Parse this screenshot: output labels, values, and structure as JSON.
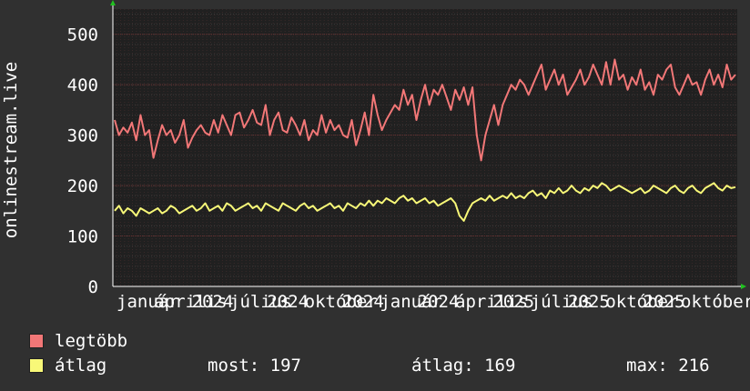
{
  "chart_data": {
    "type": "line",
    "ylabel": "onlinestream.live",
    "ylim": [
      0,
      550
    ],
    "y_ticks": [
      "0",
      "100",
      "200",
      "300",
      "400",
      "500"
    ],
    "x_tick_labels": [
      "január",
      "április",
      "2024",
      "július",
      "2024",
      "október",
      "2024",
      "január",
      "2024",
      "április",
      "2025",
      "július",
      "2025",
      "október",
      "2025",
      "október"
    ],
    "series": [
      {
        "name": "legtöbb",
        "color": "#f27777",
        "values": [
          330,
          300,
          315,
          305,
          325,
          290,
          340,
          300,
          310,
          255,
          290,
          320,
          300,
          310,
          285,
          300,
          330,
          275,
          295,
          310,
          320,
          305,
          300,
          330,
          305,
          340,
          320,
          300,
          340,
          345,
          315,
          330,
          350,
          325,
          320,
          360,
          300,
          330,
          345,
          310,
          305,
          335,
          320,
          300,
          330,
          290,
          310,
          300,
          340,
          305,
          330,
          310,
          320,
          300,
          295,
          330,
          280,
          310,
          345,
          300,
          380,
          340,
          310,
          330,
          345,
          360,
          350,
          390,
          360,
          380,
          330,
          370,
          400,
          360,
          390,
          380,
          400,
          375,
          350,
          390,
          370,
          395,
          360,
          395,
          300,
          250,
          300,
          330,
          360,
          320,
          360,
          380,
          400,
          390,
          410,
          400,
          380,
          400,
          420,
          440,
          390,
          410,
          430,
          400,
          420,
          380,
          395,
          410,
          430,
          400,
          415,
          440,
          420,
          400,
          445,
          400,
          450,
          410,
          420,
          390,
          415,
          400,
          430,
          390,
          405,
          380,
          420,
          410,
          430,
          440,
          395,
          380,
          400,
          420,
          400,
          405,
          380,
          410,
          430,
          400,
          420,
          395,
          440,
          410,
          420
        ],
        "unit": ""
      },
      {
        "name": "átlag",
        "color": "#f8f878",
        "values": [
          150,
          160,
          145,
          155,
          150,
          140,
          155,
          150,
          145,
          150,
          155,
          145,
          150,
          160,
          155,
          145,
          150,
          155,
          160,
          150,
          155,
          165,
          150,
          155,
          160,
          150,
          165,
          160,
          150,
          155,
          160,
          165,
          155,
          160,
          150,
          165,
          160,
          155,
          150,
          165,
          160,
          155,
          150,
          160,
          165,
          155,
          160,
          150,
          155,
          160,
          165,
          155,
          160,
          150,
          165,
          160,
          155,
          165,
          160,
          170,
          160,
          170,
          165,
          175,
          170,
          165,
          175,
          180,
          170,
          175,
          165,
          170,
          175,
          165,
          170,
          160,
          165,
          170,
          175,
          165,
          140,
          130,
          150,
          165,
          170,
          175,
          170,
          180,
          170,
          175,
          180,
          175,
          185,
          175,
          180,
          175,
          185,
          190,
          180,
          185,
          175,
          190,
          185,
          195,
          185,
          190,
          200,
          190,
          185,
          195,
          190,
          200,
          195,
          205,
          200,
          190,
          195,
          200,
          195,
          190,
          185,
          190,
          195,
          185,
          190,
          200,
          195,
          190,
          185,
          195,
          200,
          190,
          185,
          195,
          200,
          190,
          185,
          195,
          200,
          205,
          195,
          190,
          200,
          195,
          197
        ]
      }
    ],
    "grid": true
  },
  "legend": [
    {
      "label": "legtöbb",
      "color": "#f27777"
    },
    {
      "label": "átlag",
      "color": "#f8f878"
    }
  ],
  "stats": {
    "now": "most: 197",
    "avg": "átlag: 169",
    "max": "max: 216"
  }
}
